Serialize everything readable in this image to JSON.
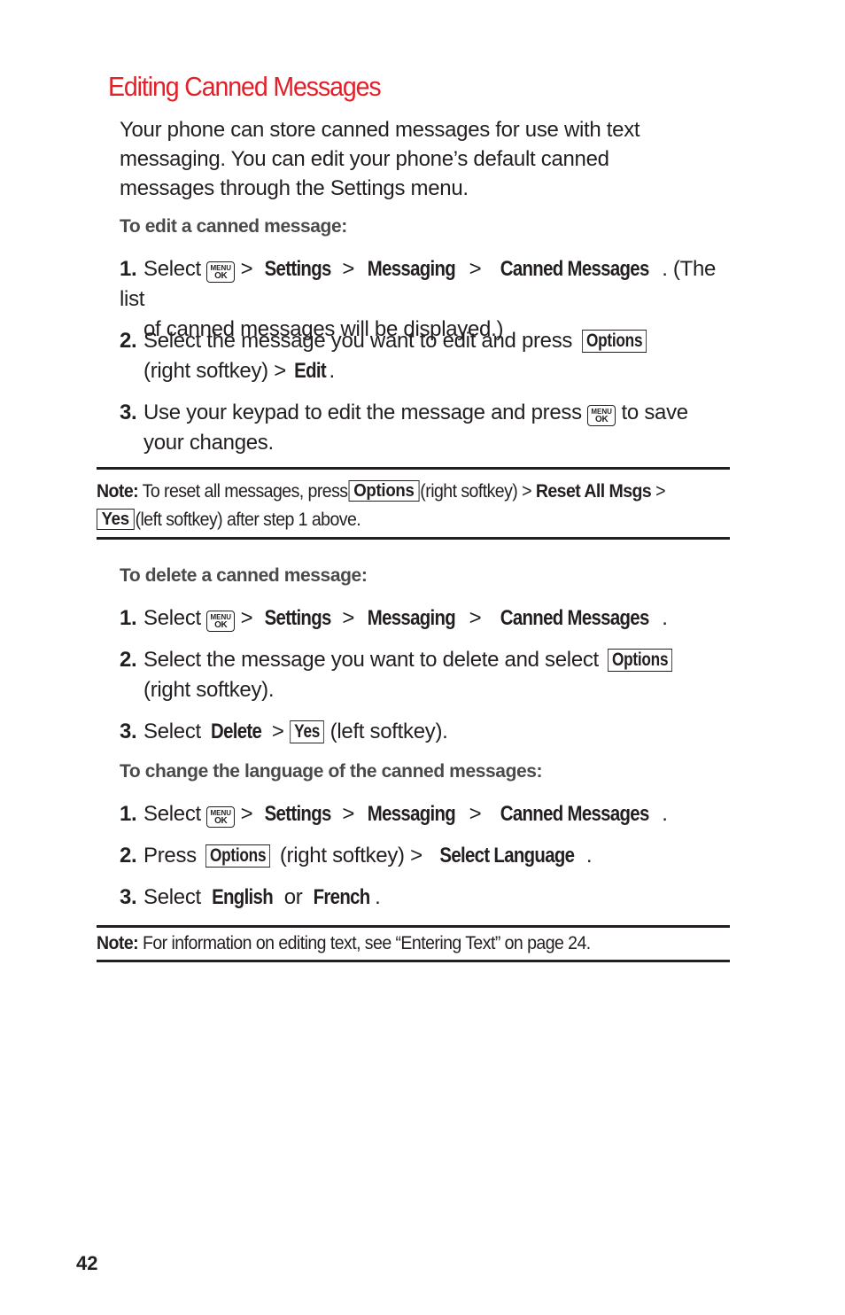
{
  "page": {
    "title": "Editing Canned Messages",
    "intro": "Your phone can store canned messages for use with text messaging. You can edit your phone’s default canned messages through the Settings menu.",
    "page_number": "42",
    "accent_color": "#e3202a"
  },
  "icons": {
    "menu_ok": {
      "top": "MENU",
      "bottom": "OK"
    }
  },
  "edit": {
    "heading": "To edit a canned message:",
    "steps": [
      {
        "num": "1.",
        "select": "Select",
        "path": [
          "Settings",
          "Messaging",
          "Canned Messages"
        ],
        "tail": ". (The list",
        "cont": "of canned messages will be displayed.)"
      },
      {
        "num": "2.",
        "text": "Select the message you want to edit and press",
        "softkey": "Options",
        "cont_a": "(right softkey) >",
        "cont_bold": "Edit",
        "cont_b": "."
      },
      {
        "num": "3.",
        "text": "Use your keypad to edit the message and press",
        "tail": "to save",
        "cont": "your changes."
      }
    ]
  },
  "note1": {
    "label": "Note:",
    "text_a": "To reset all messages, press",
    "softkey_a": "Options",
    "text_b": "(right softkey) >",
    "bold_b": "Reset All Msgs",
    "text_c": ">",
    "softkey_b": "Yes",
    "text_d": "(left softkey) after step 1 above."
  },
  "delete": {
    "heading": "To delete a canned message:",
    "steps": [
      {
        "num": "1.",
        "select": "Select",
        "path": [
          "Settings",
          "Messaging",
          "Canned Messages"
        ],
        "tail": "."
      },
      {
        "num": "2.",
        "text": "Select the message you want to delete and select",
        "softkey": "Options",
        "cont": "(right softkey)."
      },
      {
        "num": "3.",
        "select": "Select",
        "bold": "Delete",
        "softkey": "Yes",
        "tail": "(left softkey)."
      }
    ]
  },
  "language": {
    "heading": "To change the language of the canned messages:",
    "steps": [
      {
        "num": "1.",
        "select": "Select",
        "path": [
          "Settings",
          "Messaging",
          "Canned Messages"
        ],
        "tail": "."
      },
      {
        "num": "2.",
        "press": "Press",
        "softkey": "Options",
        "mid": "(right softkey) >",
        "bold": "Select Language",
        "tail": "."
      },
      {
        "num": "3.",
        "select": "Select",
        "opt1": "English",
        "or": "or",
        "opt2": "French",
        "tail": "."
      }
    ]
  },
  "note2": {
    "label": "Note:",
    "text": "For information on editing text, see “Entering Text” on page 24."
  }
}
